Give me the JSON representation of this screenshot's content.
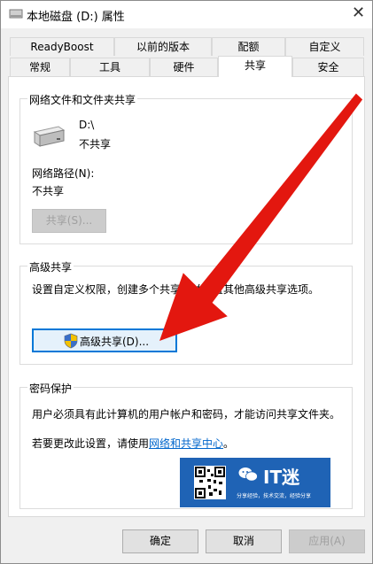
{
  "window": {
    "title": "本地磁盘 (D:) 属性",
    "close_icon": "close-icon"
  },
  "tabs_row1": [
    "ReadyBoost",
    "以前的版本",
    "配额",
    "自定义"
  ],
  "tabs_row2": [
    "常规",
    "工具",
    "硬件",
    "共享",
    "安全"
  ],
  "active_tab": "共享",
  "network_sharing": {
    "title": "网络文件和文件夹共享",
    "drive_label": "D:\\",
    "status": "不共享",
    "path_label": "网络路径(N):",
    "path_value": "不共享",
    "share_button": "共享(S)..."
  },
  "advanced_sharing": {
    "title": "高级共享",
    "description": "设置自定义权限，创建多个共享，并设置其他高级共享选项。",
    "button": "高级共享(D)..."
  },
  "password_protection": {
    "title": "密码保护",
    "description": "用户必须具有此计算机的用户帐户和密码，才能访问共享文件夹。",
    "change_prefix": "若要更改此设置，请使用",
    "link": "网络和共享中心",
    "change_suffix": "。"
  },
  "watermark": {
    "brand": "IT迷",
    "slogan": "分享经验，技术交流，经验分享"
  },
  "buttons": {
    "ok": "确定",
    "cancel": "取消",
    "apply": "应用(A)"
  },
  "colors": {
    "accent": "#0078d7",
    "arrow": "#e3170f",
    "watermark_bg": "#1f63b5"
  }
}
